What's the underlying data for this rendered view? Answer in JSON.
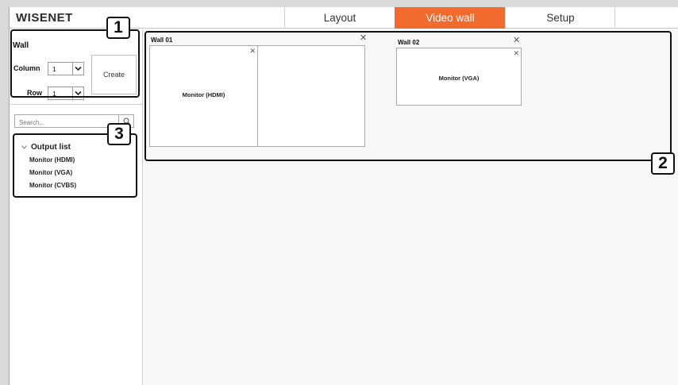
{
  "app": {
    "logo": "WISENET"
  },
  "tabs": [
    {
      "label": "Layout",
      "active": false
    },
    {
      "label": "Video wall",
      "active": true
    },
    {
      "label": "Setup",
      "active": false
    }
  ],
  "accent_color": "#f26a2e",
  "sidebar": {
    "wall_title": "Wall",
    "column_label": "Column",
    "column_value": "1",
    "row_label": "Row",
    "row_value": "1",
    "create_label": "Create",
    "search_placeholder": "Search...",
    "output_list_label": "Output list",
    "output_items": [
      "Monitor (HDMI)",
      "Monitor (VGA)",
      "Monitor (CVBS)"
    ]
  },
  "walls": [
    {
      "name": "Wall 01",
      "cells": [
        {
          "label": "Monitor (HDMI)"
        },
        {
          "label": ""
        }
      ]
    },
    {
      "name": "Wall 02",
      "cells": [
        {
          "label": "Monitor (VGA)"
        }
      ]
    }
  ],
  "callouts": [
    "1",
    "2",
    "3"
  ],
  "icons": {
    "dropdown": "chevron-down-icon",
    "search": "search-icon",
    "close": "close-icon",
    "expand": "chevron-down-icon"
  }
}
